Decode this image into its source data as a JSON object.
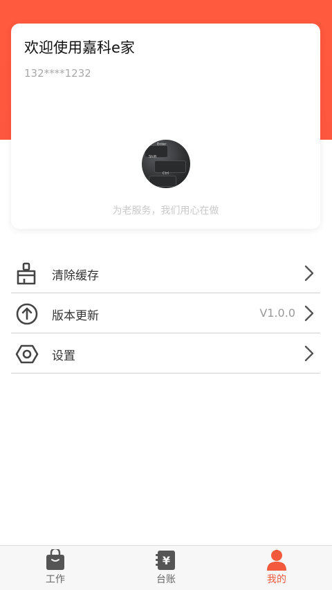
{
  "profile": {
    "welcome_text": "欢迎使用嘉科e家",
    "phone_masked": "132****1232",
    "avatar_key_labels": [
      "Enter",
      "Shift",
      "Ctrl"
    ],
    "slogan": "为老服务，我们用心在做"
  },
  "menu": {
    "items": [
      {
        "label": "清除缓存",
        "icon": "broom-icon"
      },
      {
        "label": "版本更新",
        "icon": "arrow-up-circle-icon",
        "value": "V1.0.0"
      },
      {
        "label": "设置",
        "icon": "hexagon-settings-icon"
      }
    ]
  },
  "tabbar": {
    "tabs": [
      {
        "label": "工作",
        "icon": "work-bag-icon",
        "active": false
      },
      {
        "label": "台账",
        "icon": "ledger-yen-icon",
        "active": false
      },
      {
        "label": "我的",
        "icon": "user-icon",
        "active": true
      }
    ]
  },
  "colors": {
    "brand_red": "#fe5740",
    "active_tab": "#f35a3d",
    "text_dark": "#333333",
    "text_muted": "#999999"
  }
}
